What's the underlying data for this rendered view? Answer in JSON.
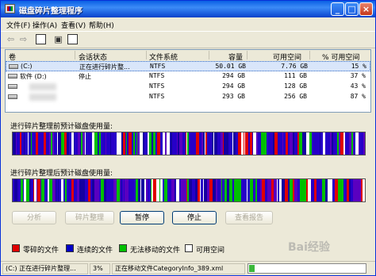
{
  "window": {
    "title": "磁盘碎片整理程序"
  },
  "titlebar_buttons": {
    "minimize": "_",
    "maximize": "□",
    "close": "×"
  },
  "menu": [
    "文件(F)",
    "操作(A)",
    "查看(V)",
    "帮助(H)"
  ],
  "toolbar_icons": [
    "back-icon",
    "forward-icon",
    "properties-icon",
    "refresh-icon",
    "help-icon"
  ],
  "volume_list": {
    "columns": [
      "卷",
      "会话状态",
      "文件系统",
      "容量",
      "可用空间",
      "% 可用空间"
    ],
    "rows": [
      {
        "volume": "(C:)",
        "status": "正在进行碎片整...",
        "fs": "NTFS",
        "capacity": "50.01 GB",
        "free": "7.76 GB",
        "pct": "15 %",
        "selected": true
      },
      {
        "volume": "软件 (D:)",
        "status": "停止",
        "fs": "NTFS",
        "capacity": "294 GB",
        "free": "111 GB",
        "pct": "37 %",
        "selected": false
      },
      {
        "volume": "",
        "status": "",
        "fs": "NTFS",
        "capacity": "294 GB",
        "free": "128 GB",
        "pct": "43 %",
        "selected": false
      },
      {
        "volume": "",
        "status": "",
        "fs": "NTFS",
        "capacity": "293 GB",
        "free": "256 GB",
        "pct": "87 %",
        "selected": false
      }
    ]
  },
  "before_label": "进行碎片整理前预计磁盘使用量:",
  "after_label": "进行碎片整理后预计磁盘使用量:",
  "buttons": [
    {
      "label": "分析",
      "enabled": false
    },
    {
      "label": "碎片整理",
      "enabled": false
    },
    {
      "label": "暂停",
      "enabled": true
    },
    {
      "label": "停止",
      "enabled": true
    },
    {
      "label": "查看报告",
      "enabled": false
    }
  ],
  "legend": [
    {
      "label": "零碎的文件",
      "color": "#E00000"
    },
    {
      "label": "连续的文件",
      "color": "#0000C8"
    },
    {
      "label": "无法移动的文件",
      "color": "#00C000"
    },
    {
      "label": "可用空间",
      "color": "#FFFFFF"
    }
  ],
  "status": {
    "volume_text": "(C:) 正在进行碎片整理...",
    "percent": "3%",
    "moving_text": "正在移动文件CategoryInfo_389.xml",
    "progress": 0.03
  },
  "watermark": "Bai经验"
}
